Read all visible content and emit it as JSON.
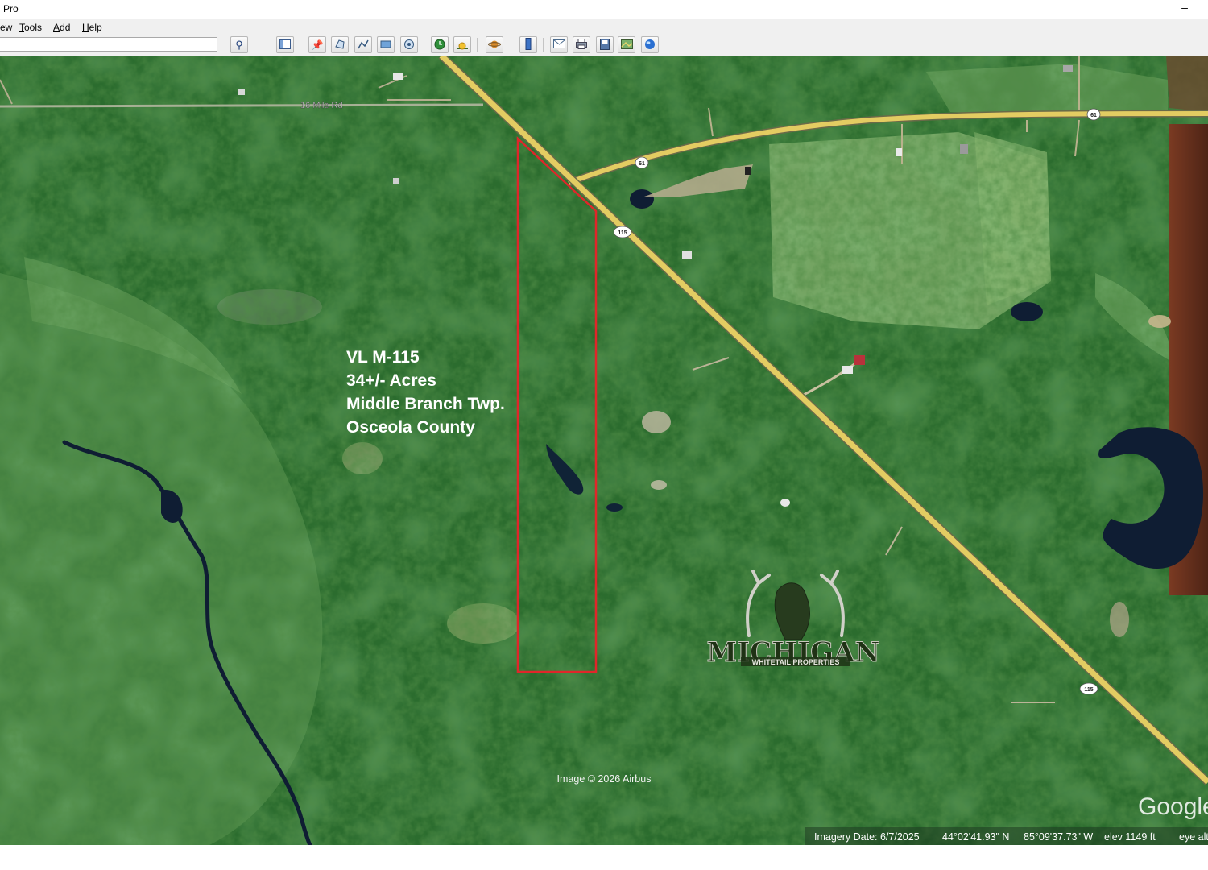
{
  "window": {
    "title": "Pro",
    "minimize_label": "–"
  },
  "menu": {
    "items": [
      {
        "prefix": "",
        "mnemonic": "",
        "rest": "ew"
      },
      {
        "prefix": "",
        "mnemonic": "T",
        "rest": "ools"
      },
      {
        "prefix": "",
        "mnemonic": "A",
        "rest": "dd"
      },
      {
        "prefix": "",
        "mnemonic": "H",
        "rest": "elp"
      }
    ]
  },
  "toolbar": {
    "search_value": "",
    "icons": [
      "search-icon",
      "sidebar-icon",
      "placemark-icon",
      "polygon-icon",
      "path-icon",
      "overlay-icon",
      "tour-icon",
      "history-icon",
      "sun-icon",
      "planet-icon",
      "ruler-icon",
      "email-icon",
      "print-icon",
      "save-image-icon",
      "map-view-icon",
      "earth-icon"
    ]
  },
  "map": {
    "road_labels": {
      "mile16": "16 Mile Rd",
      "shield_61_a": "61",
      "shield_61_b": "61",
      "shield_115_a": "115",
      "shield_115_b": "115"
    },
    "listing": {
      "line1": "VL M-115",
      "line2": "34+/- Acres",
      "line3": "Middle Branch Twp.",
      "line4": "Osceola County"
    },
    "logo": {
      "word": "MICHIGAN",
      "tagline": "WHITETAIL PROPERTIES"
    },
    "copyright": "Image © 2026 Airbus",
    "brand": "Google",
    "status": {
      "imagery_date": "Imagery Date: 6/7/2025",
      "latitude": "44°02'41.93\" N",
      "longitude": "85°09'37.73\" W",
      "elevation": "elev  1149 ft",
      "eye_alt": "eye alt"
    },
    "colors": {
      "boundary": "#e0262a",
      "highway": "#e3cc62",
      "forest": "#2a6a2c",
      "water": "#0f1d33"
    }
  }
}
